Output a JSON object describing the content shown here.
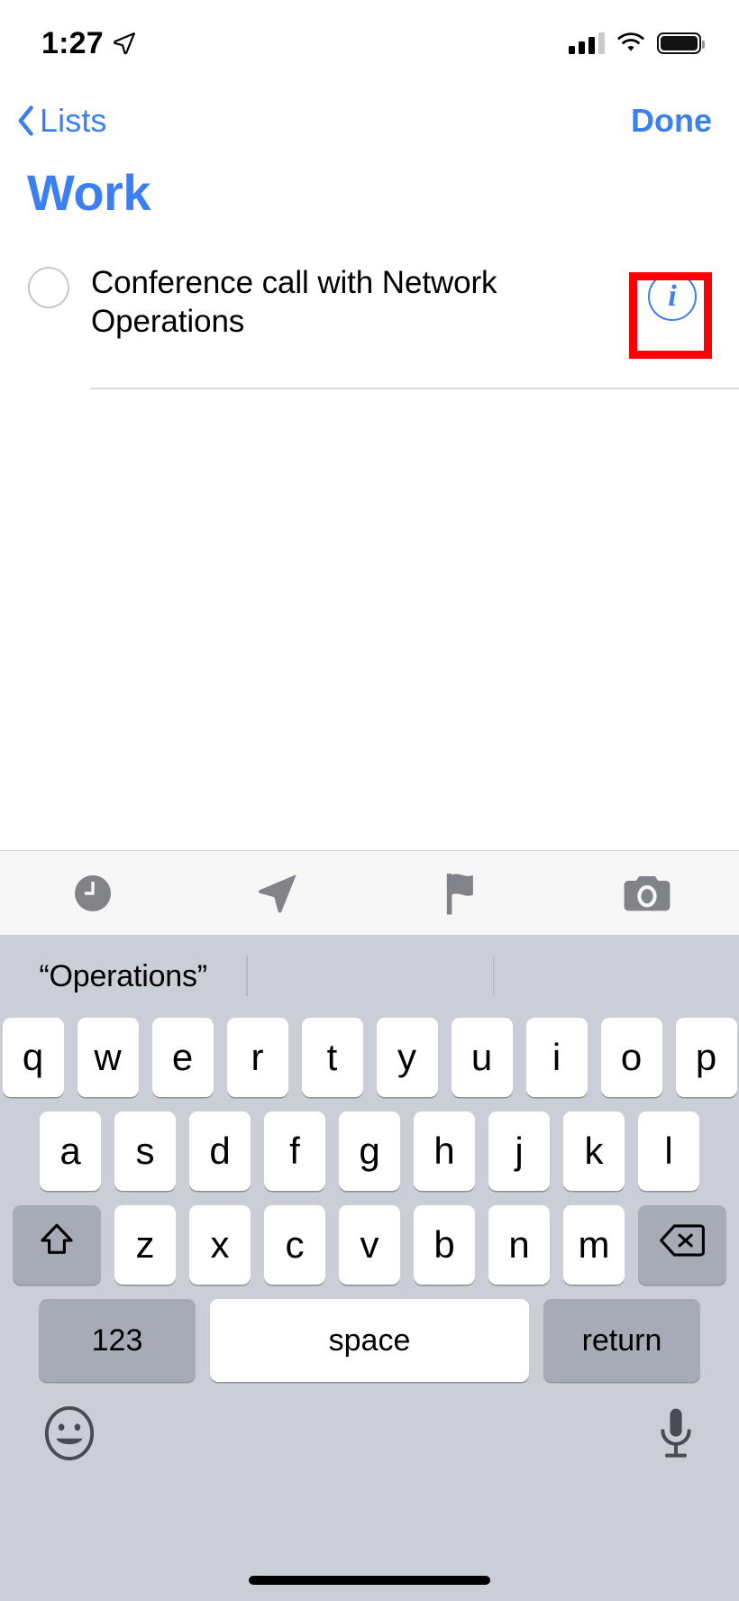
{
  "status_bar": {
    "time": "1:27",
    "location_icon": "location-arrow-icon",
    "signal_icon": "cellular-signal-icon",
    "signal_bars_filled": 3,
    "signal_bars_total": 4,
    "wifi_icon": "wifi-icon",
    "battery_icon": "battery-icon",
    "battery_level_pct": 100
  },
  "nav_bar": {
    "back_icon": "chevron-left-icon",
    "back_label": "Lists",
    "done_label": "Done"
  },
  "list": {
    "title": "Work",
    "accent_color": "#3b7ff5",
    "reminders": [
      {
        "text": "Conference call with Network Operations",
        "completed": false,
        "checkbox_icon": "circle-checkbox-icon",
        "info_icon": "info-circle-icon",
        "info_label": "i"
      }
    ]
  },
  "annotation": {
    "type": "highlight-rectangle",
    "color": "#fb0007",
    "target": "info-circle-button"
  },
  "accessory_toolbar": {
    "buttons": [
      {
        "name": "clock-icon",
        "label": "Remind me on a day"
      },
      {
        "name": "location-arrow-icon",
        "label": "Remind me at a location"
      },
      {
        "name": "flag-icon",
        "label": "Flag"
      },
      {
        "name": "camera-icon",
        "label": "Add attachment"
      }
    ]
  },
  "keyboard": {
    "predictive": [
      {
        "text": "“Operations”"
      },
      {
        "text": ""
      },
      {
        "text": ""
      }
    ],
    "row1": [
      "q",
      "w",
      "e",
      "r",
      "t",
      "y",
      "u",
      "i",
      "o",
      "p"
    ],
    "row2": [
      "a",
      "s",
      "d",
      "f",
      "g",
      "h",
      "j",
      "k",
      "l"
    ],
    "row3": [
      "z",
      "x",
      "c",
      "v",
      "b",
      "n",
      "m"
    ],
    "shift_icon": "shift-arrow-icon",
    "backspace_icon": "backspace-delete-icon",
    "numbers_label": "123",
    "space_label": "space",
    "return_label": "return",
    "emoji_icon": "emoji-smiley-icon",
    "dictation_icon": "microphone-icon",
    "background_color": "#cbced6",
    "key_color": "#ffffff",
    "modifier_key_color": "#a7abb5"
  }
}
